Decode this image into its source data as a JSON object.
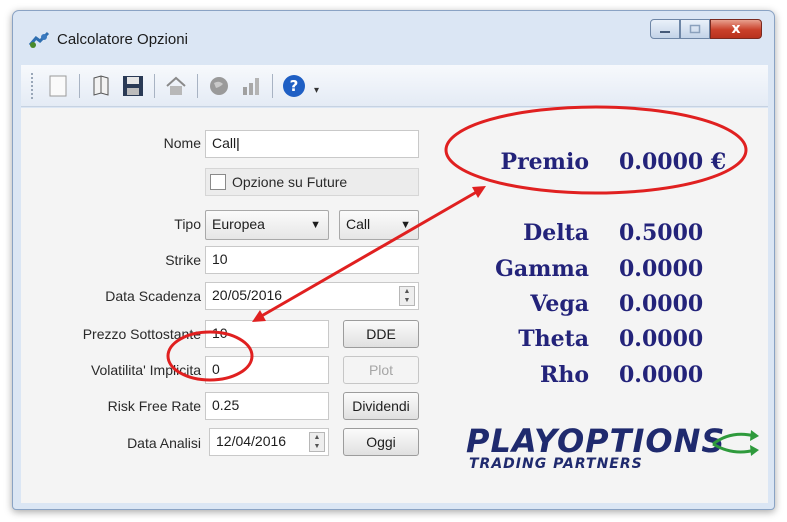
{
  "window": {
    "title": "Calcolatore Opzioni",
    "buttons": {
      "close": "x"
    }
  },
  "toolbar": {
    "icons": [
      "new-document-icon",
      "open-book-icon",
      "save-icon",
      "home-icon",
      "globe-icon",
      "chart-icon",
      "help-icon"
    ],
    "help_glyph": "?",
    "more": "▾"
  },
  "form": {
    "nome": {
      "label": "Nome",
      "value": "Call"
    },
    "future": {
      "label": "Opzione su Future",
      "checked": false
    },
    "tipo": {
      "label": "Tipo",
      "value": "Europea",
      "option": "Call"
    },
    "strike": {
      "label": "Strike",
      "value": "10"
    },
    "scadenza": {
      "label": "Data Scadenza",
      "value": "20/05/2016"
    },
    "sottostante": {
      "label": "Prezzo Sottostante",
      "value": "10",
      "button": "DDE"
    },
    "volatilita": {
      "label": "Volatilita' Implicita",
      "value": "0",
      "button": "Plot"
    },
    "riskfree": {
      "label": "Risk Free Rate",
      "value": "0.25",
      "button": "Dividendi"
    },
    "analisi": {
      "label": "Data Analisi",
      "value": "12/04/2016",
      "button": "Oggi"
    }
  },
  "results": {
    "premio": {
      "label": "Premio",
      "value": "0.0000 €"
    },
    "delta": {
      "label": "Delta",
      "value": "0.5000"
    },
    "gamma": {
      "label": "Gamma",
      "value": "0.0000"
    },
    "vega": {
      "label": "Vega",
      "value": "0.0000"
    },
    "theta": {
      "label": "Theta",
      "value": "0.0000"
    },
    "rho": {
      "label": "Rho",
      "value": "0.0000"
    }
  },
  "logo": {
    "main": "PLAYOPTIONS",
    "sub": "TRADING PARTNERS"
  },
  "colors": {
    "accent_text": "#23237a",
    "annotation": "#e02020",
    "logo": "#1f2a6e",
    "logo_arrow": "#2e9a3c"
  }
}
